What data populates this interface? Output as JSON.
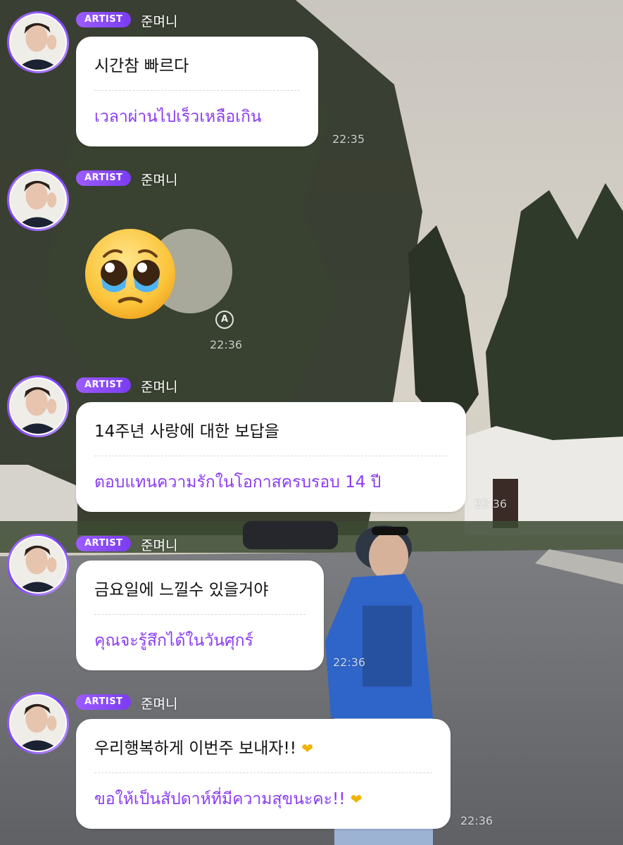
{
  "badge_label": "ARTIST",
  "colors": {
    "accent": "#8a3cf2",
    "badge": "#9c5cff",
    "bubble": "#ffffff"
  },
  "messages": [
    {
      "nickname": "준며니",
      "original": "시간참 빠르다",
      "translation": "เวลาผ่านไปเร็วเหลือเกิน",
      "time": "22:35"
    },
    {
      "nickname": "준며니",
      "emoji": "pleading-face-with-tears",
      "time": "22:36"
    },
    {
      "nickname": "준며니",
      "original": "14주년 사랑에 대한 보답을",
      "translation": "ตอบแทนความรักในโอกาสครบรอบ 14 ปี",
      "time": "22:36"
    },
    {
      "nickname": "준며니",
      "original": "금요일에 느낄수 있을거야",
      "translation": "คุณจะรู้สึกได้ในวันศุกร์",
      "time": "22:36"
    },
    {
      "nickname": "준며니",
      "original": "우리행복하게 이번주 보내자!!",
      "translation": "ขอให้เป็นสัปดาห์ที่มีความสุขนะคะ!!",
      "time": "22:36"
    }
  ],
  "auto_translate_icon": "translate-a-icon",
  "auto_translate_letter": "A"
}
